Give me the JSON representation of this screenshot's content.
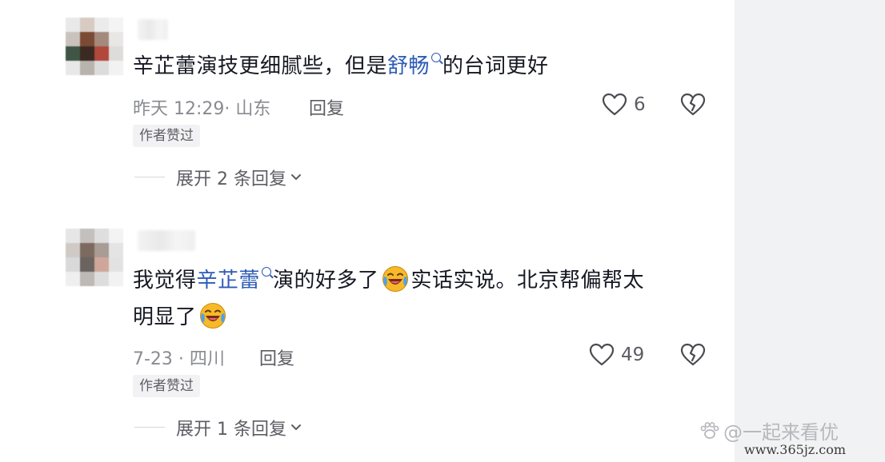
{
  "comments": [
    {
      "text_pre": "辛芷蕾演技更细腻些，但是",
      "link": "舒畅",
      "text_post": "的台词更好",
      "meta": "昨天 12:29· 山东",
      "reply_label": "回复",
      "badge": "作者赞过",
      "likes": "6",
      "expand_label": "展开 2 条回复"
    },
    {
      "text_pre": "我觉得",
      "link": "辛芷蕾",
      "text_post": "演的好多了",
      "text_mid": "实话实说。北京帮偏帮太",
      "text_line2": "明显了",
      "meta": "7-23 · 四川",
      "reply_label": "回复",
      "badge": "作者赞过",
      "likes": "49",
      "expand_label": "展开 1 条回复"
    }
  ],
  "watermark": {
    "handle": "@一起来看优",
    "site": "www.365jz.com"
  },
  "icons": {
    "search": "search-icon",
    "like": "heart-icon",
    "dislike": "broken-heart-icon",
    "expand": "chevron-down-icon",
    "emoji": "laughing-crying-emoji"
  },
  "colors": {
    "link": "#2d5bb5",
    "text": "#161823",
    "meta": "#8a8b91",
    "side_panel": "#f1f2f4"
  }
}
